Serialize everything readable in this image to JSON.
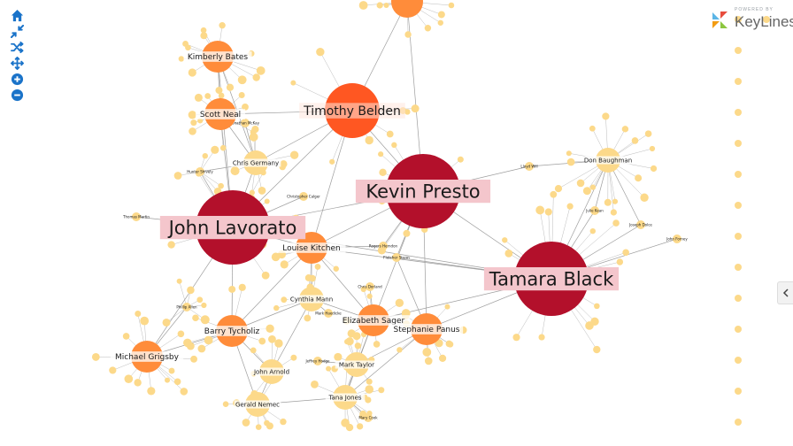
{
  "brand": {
    "powered_by": "POWERED BY",
    "name": "KeyLines",
    "colors": [
      "#5bb5e6",
      "#f39c12",
      "#8cc63f",
      "#e74c3c"
    ]
  },
  "toolbar": {
    "color": "#1a73c9",
    "items": [
      {
        "name": "home-icon",
        "label": "home"
      },
      {
        "name": "shrink-icon",
        "label": "fit"
      },
      {
        "name": "shuffle-icon",
        "label": "layout"
      },
      {
        "name": "move-icon",
        "label": "pan"
      },
      {
        "name": "zoom-in-icon",
        "label": "zoom in"
      },
      {
        "name": "zoom-out-icon",
        "label": "zoom out"
      }
    ]
  },
  "collapse": {
    "icon": "chevron-left-icon"
  },
  "colors": {
    "dark_red": "#b3102b",
    "red_orange": "#ff5722",
    "orange": "#ff8c3a",
    "yellow": "#fcd98a",
    "edge": "#9e9e9e",
    "label_band": "#f4c6cc"
  },
  "graph": {
    "nodes": [
      {
        "id": "john",
        "label": "John Lavorato",
        "size": "xl",
        "color": "dark_red"
      },
      {
        "id": "kevin",
        "label": "Kevin Presto",
        "size": "xl",
        "color": "dark_red"
      },
      {
        "id": "tamara",
        "label": "Tamara Black",
        "size": "xl",
        "color": "dark_red"
      },
      {
        "id": "timothy",
        "label": "Timothy Belden",
        "size": "l",
        "color": "red_orange"
      },
      {
        "id": "top",
        "label": "",
        "size": "m",
        "color": "orange"
      },
      {
        "id": "kimberly",
        "label": "Kimberly Bates",
        "size": "m",
        "color": "orange"
      },
      {
        "id": "scott",
        "label": "Scott Neal",
        "size": "m",
        "color": "orange"
      },
      {
        "id": "louise",
        "label": "Louise Kitchen",
        "size": "m",
        "color": "orange"
      },
      {
        "id": "michael",
        "label": "Michael Grigsby",
        "size": "m",
        "color": "orange"
      },
      {
        "id": "barry",
        "label": "Barry Tycholiz",
        "size": "m",
        "color": "orange"
      },
      {
        "id": "elizabeth",
        "label": "Elizabeth Sager",
        "size": "m",
        "color": "orange"
      },
      {
        "id": "stephanie",
        "label": "Stephanie Panus",
        "size": "m",
        "color": "orange"
      },
      {
        "id": "chris",
        "label": "Chris Germany",
        "size": "s",
        "color": "yellow"
      },
      {
        "id": "don",
        "label": "Don Baughman",
        "size": "s",
        "color": "yellow"
      },
      {
        "id": "cynthia",
        "label": "Cynthia Mann",
        "size": "s",
        "color": "yellow"
      },
      {
        "id": "johnarnold",
        "label": "John Arnold",
        "size": "s",
        "color": "yellow"
      },
      {
        "id": "gerald",
        "label": "Gerald Nemec",
        "size": "s",
        "color": "yellow"
      },
      {
        "id": "tana",
        "label": "Tana Jones",
        "size": "s",
        "color": "yellow"
      },
      {
        "id": "marktaylor",
        "label": "Mark Taylor",
        "size": "s",
        "color": "yellow"
      },
      {
        "id": "rogers",
        "label": "Rogers Herndon",
        "size": "xs",
        "color": "yellow"
      },
      {
        "id": "fletcher",
        "label": "Fletcher Sturm",
        "size": "xs",
        "color": "yellow"
      },
      {
        "id": "hunter",
        "label": "Hunter Shively",
        "size": "xs",
        "color": "yellow"
      },
      {
        "id": "jonathan",
        "label": "Jonathan McKay",
        "size": "xs",
        "color": "yellow"
      },
      {
        "id": "lloyd",
        "label": "Lloyd Will",
        "size": "xs",
        "color": "yellow"
      },
      {
        "id": "phillip",
        "label": "Phillip Allen",
        "size": "xs",
        "color": "yellow"
      },
      {
        "id": "marycook",
        "label": "Mary Cook",
        "size": "xs",
        "color": "yellow"
      },
      {
        "id": "jeffrey",
        "label": "Jeffrey Hodge",
        "size": "xs",
        "color": "yellow"
      },
      {
        "id": "markhaedicke",
        "label": "Mark Haedicke",
        "size": "xs",
        "color": "yellow"
      },
      {
        "id": "chriscorland",
        "label": "Chris Dorland",
        "size": "xs",
        "color": "yellow"
      },
      {
        "id": "thomas",
        "label": "Thomas Martin",
        "size": "xs",
        "color": "yellow"
      },
      {
        "id": "christopher",
        "label": "Christopher Calger",
        "size": "xs",
        "color": "yellow"
      },
      {
        "id": "joseph",
        "label": "Joseph Dolce",
        "size": "xs",
        "color": "yellow"
      },
      {
        "id": "johnforney",
        "label": "John Forney",
        "size": "xs",
        "color": "yellow"
      },
      {
        "id": "juliekean",
        "label": "Julie Kean",
        "size": "xs",
        "color": "yellow"
      }
    ]
  }
}
